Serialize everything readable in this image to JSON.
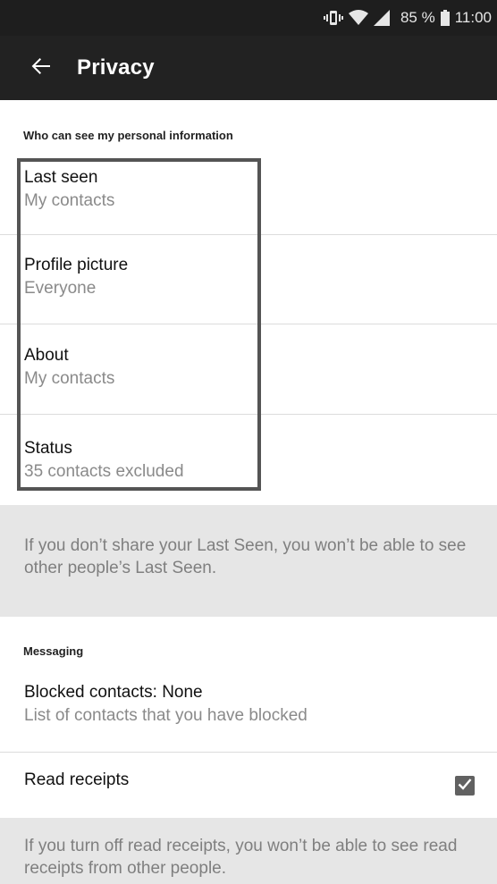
{
  "status_bar": {
    "battery_percent": "85 %",
    "time": "11:00"
  },
  "app_bar": {
    "back_icon": "arrow-left-icon",
    "title": "Privacy"
  },
  "personal_info": {
    "header": "Who can see my personal information",
    "items": [
      {
        "title": "Last seen",
        "value": "My contacts"
      },
      {
        "title": "Profile picture",
        "value": "Everyone"
      },
      {
        "title": "About",
        "value": "My contacts"
      },
      {
        "title": "Status",
        "value": "35 contacts excluded"
      }
    ],
    "note": "If you don’t share your Last Seen, you won’t be able to see other people’s Last Seen."
  },
  "messaging": {
    "header": "Messaging",
    "blocked": {
      "title": "Blocked contacts: None",
      "subtitle": "List of contacts that you have blocked"
    },
    "read_receipts": {
      "title": "Read receipts",
      "checked": true
    },
    "note": "If you turn off read receipts, you won’t be able to see read receipts from other people."
  },
  "colors": {
    "app_bar": "#222222",
    "status_bar": "#1e1e1e",
    "info_box": "#e6e6e6",
    "checkbox": "#616161"
  }
}
